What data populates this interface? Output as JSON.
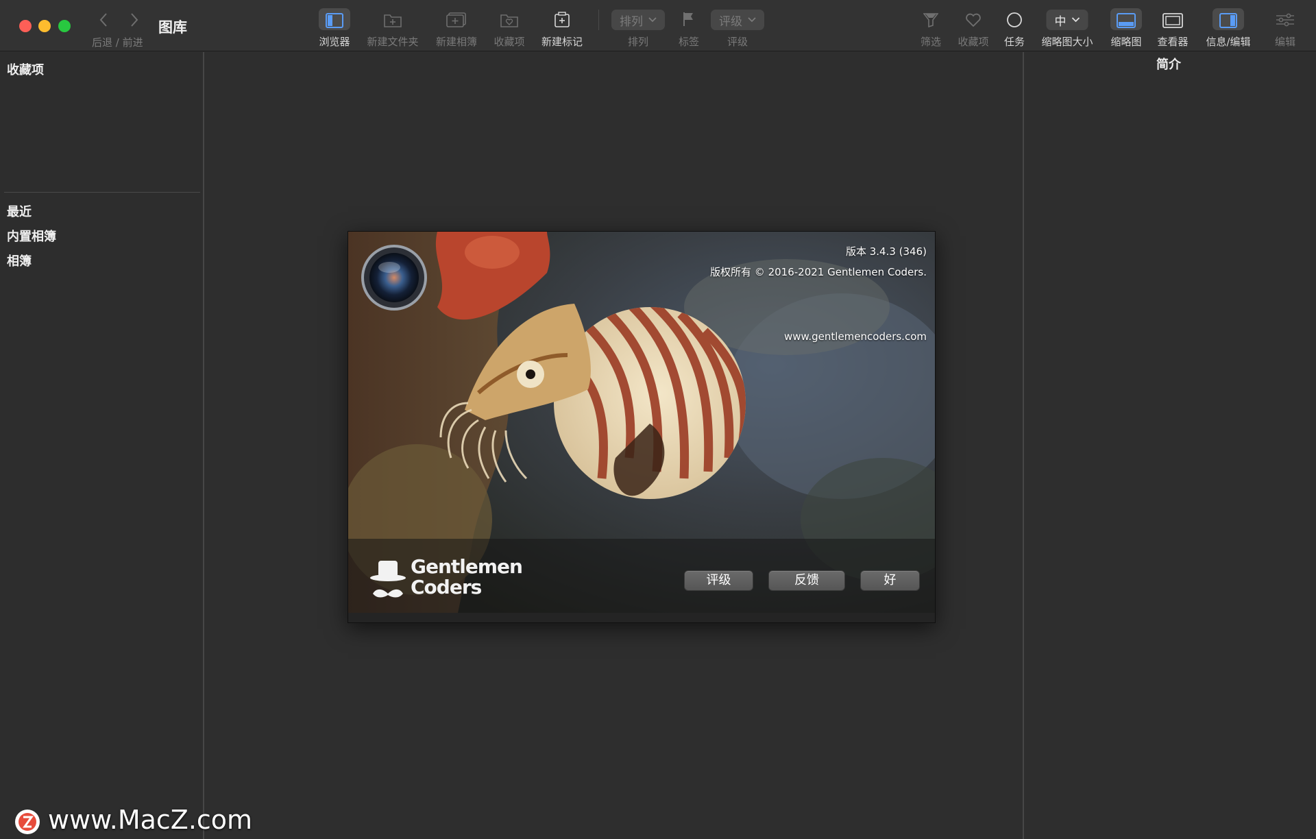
{
  "window": {
    "title": "图库",
    "nav_caption": "后退 / 前进"
  },
  "toolbar": {
    "items": [
      {
        "label": "浏览器",
        "icon": "browser-icon",
        "active": true
      },
      {
        "label": "新建文件夹",
        "icon": "new-folder-icon",
        "enabled": false
      },
      {
        "label": "新建相簿",
        "icon": "new-album-icon",
        "enabled": false
      },
      {
        "label": "收藏项",
        "icon": "favorite-folder-icon",
        "enabled": false
      },
      {
        "label": "新建标记",
        "icon": "new-tag-icon",
        "enabled": true
      },
      {
        "label": "排列",
        "popup": "排列",
        "enabled": false
      },
      {
        "label": "标签",
        "icon": "flag-icon",
        "enabled": false
      },
      {
        "label": "评级",
        "popup": "评级",
        "enabled": false
      },
      {
        "label": "筛选",
        "icon": "filter-icon",
        "enabled": false
      },
      {
        "label": "收藏项",
        "icon": "heart-icon",
        "enabled": false
      },
      {
        "label": "任务",
        "icon": "circle-icon",
        "enabled": true
      },
      {
        "label": "缩略图大小",
        "popup": "中",
        "enabled": true
      },
      {
        "label": "缩略图",
        "icon": "thumbnails-icon",
        "active": true
      },
      {
        "label": "查看器",
        "icon": "viewer-icon",
        "enabled": true
      },
      {
        "label": "信息/编辑",
        "icon": "info-edit-icon",
        "active": true
      },
      {
        "label": "编辑",
        "icon": "sliders-icon",
        "enabled": false
      }
    ]
  },
  "sidebar": {
    "header": "收藏项",
    "items": [
      "最近",
      "内置相簿",
      "相簿"
    ]
  },
  "inspector": {
    "title": "简介"
  },
  "about": {
    "version": "版本 3.4.3 (346)",
    "copyright": "版权所有 © 2016-2021 Gentlemen Coders.",
    "url": "www.gentlemencoders.com",
    "brand_line1": "Gentlemen",
    "brand_line2": "Coders",
    "buttons": {
      "rate": "评级",
      "feedback": "反馈",
      "ok": "好"
    }
  },
  "watermark": {
    "text": "www.MacZ.com",
    "logo_letter": "Z"
  },
  "colors": {
    "close": "#fe5f57",
    "minimize": "#febc2e",
    "zoom": "#28c840",
    "accent": "#4a90e2"
  }
}
